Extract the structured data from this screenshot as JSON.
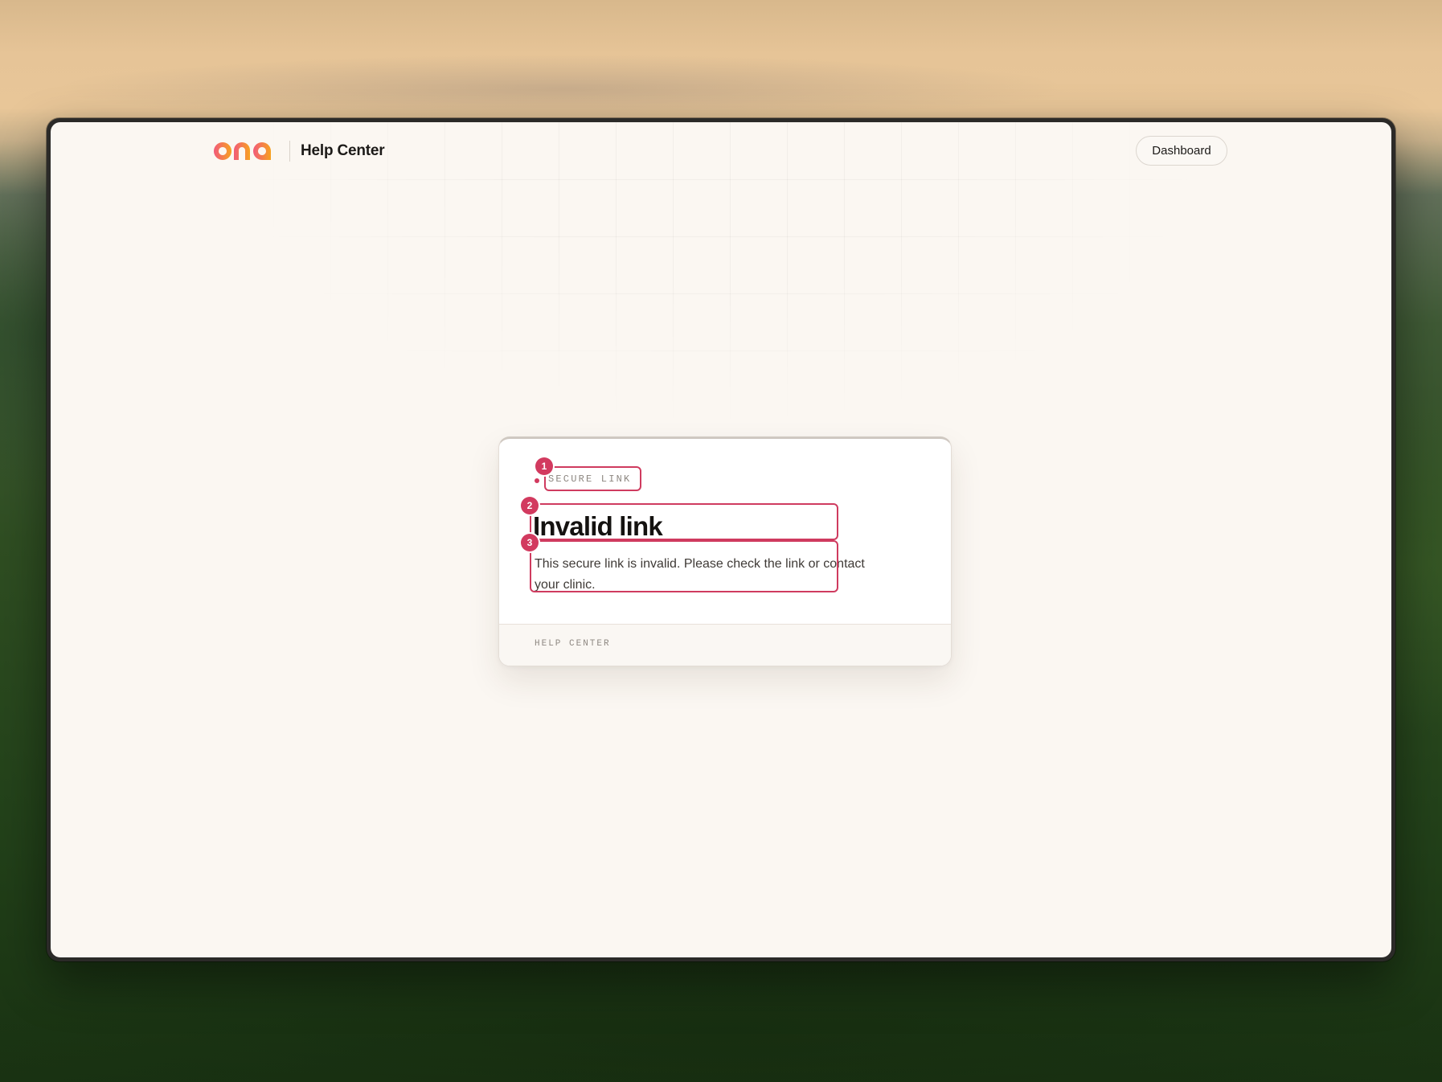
{
  "header": {
    "brand_name": "ona",
    "app_name": "Help Center",
    "dashboard_label": "Dashboard"
  },
  "card": {
    "eyebrow": "SECURE LINK",
    "title": "Invalid link",
    "description": "This secure link is invalid. Please check the link or contact your clinic.",
    "footer": "HELP CENTER"
  },
  "annotations": {
    "badge_1": "1",
    "badge_2": "2",
    "badge_3": "3"
  },
  "colors": {
    "logo_start": "#f25a7a",
    "logo_end": "#f7a21f",
    "annotation": "#cf3b5f",
    "page_background": "#fbf7f2"
  }
}
